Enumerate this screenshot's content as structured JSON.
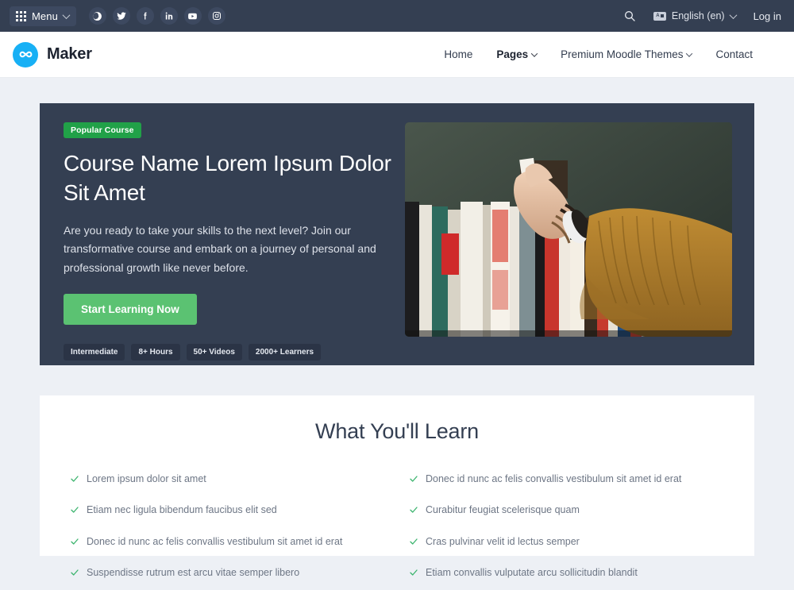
{
  "topbar": {
    "menu_label": "Menu",
    "menu_icon": "grid-dots-icon",
    "socials": [
      {
        "name": "globe-icon",
        "title": "Website"
      },
      {
        "name": "twitter-icon",
        "title": "Twitter"
      },
      {
        "name": "facebook-icon",
        "title": "Facebook"
      },
      {
        "name": "linkedin-icon",
        "title": "LinkedIn"
      },
      {
        "name": "youtube-icon",
        "title": "YouTube"
      },
      {
        "name": "instagram-icon",
        "title": "Instagram"
      }
    ],
    "search_icon": "search-icon",
    "language": "English (en)",
    "language_icon": "translate-icon",
    "login_label": "Log in"
  },
  "header": {
    "brand_name": "Maker",
    "brand_icon": "infinity-logo-icon",
    "nav": [
      {
        "label": "Home",
        "has_caret": false,
        "active": false
      },
      {
        "label": "Pages",
        "has_caret": true,
        "active": true
      },
      {
        "label": "Premium Moodle Themes",
        "has_caret": true,
        "active": false
      },
      {
        "label": "Contact",
        "has_caret": false,
        "active": false
      }
    ]
  },
  "hero": {
    "badge": "Popular Course",
    "title": "Course Name Lorem Ipsum Dolor Sit Amet",
    "description": "Are you ready to take your skills to the next level? Join our transformative course and embark on a journey of personal and professional growth like never before.",
    "cta_label": "Start Learning Now",
    "meta": [
      "Intermediate",
      "8+ Hours",
      "50+ Videos",
      "2000+ Learners"
    ],
    "image_alt": "Hand reaching for a book on a bookshelf against a dark green wall"
  },
  "learn": {
    "heading": "What You'll Learn",
    "items_left": [
      "Lorem ipsum dolor sit amet",
      "Etiam nec ligula bibendum faucibus elit sed",
      "Donec id nunc ac felis convallis vestibulum sit amet id erat",
      "Suspendisse rutrum est arcu vitae semper libero"
    ],
    "items_right": [
      "Donec id nunc ac felis convallis vestibulum sit amet id erat",
      "Curabitur feugiat scelerisque quam",
      "Cras pulvinar velit id lectus semper",
      "Etiam convallis vulputate arcu sollicitudin blandit"
    ],
    "check_icon": "check-icon"
  },
  "colors": {
    "page_bg": "#edf0f5",
    "dark_slate": "#343f52",
    "brand_blue": "#17b0f5",
    "badge_green": "#21a148",
    "button_green": "#5bc272",
    "check_green": "#3cb46e"
  }
}
